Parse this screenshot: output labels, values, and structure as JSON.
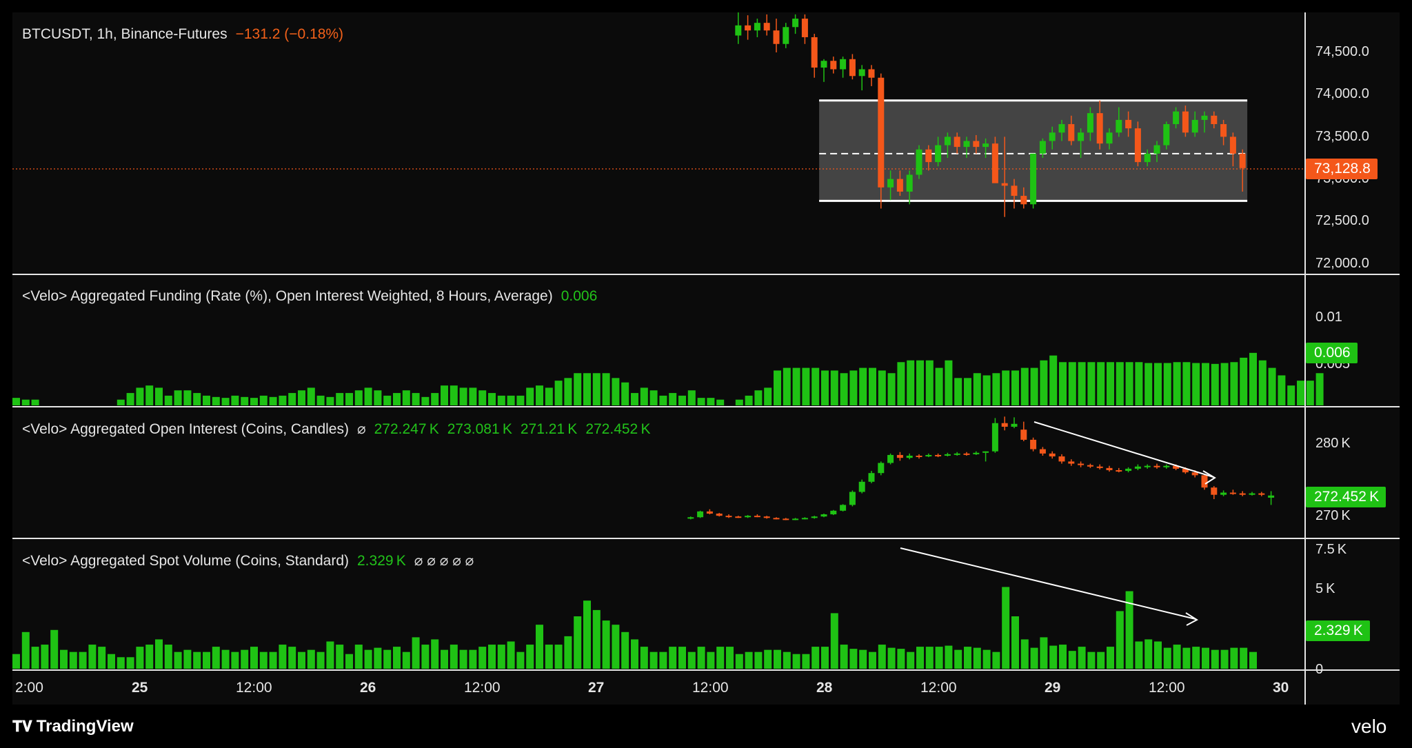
{
  "title": {
    "symbol": "BTCUSDT, 1h, Binance-Futures",
    "change": "−131.2 (−0.18%)"
  },
  "panes": {
    "funding": {
      "label": "<Velo> Aggregated Funding (Rate (%), Open Interest Weighted, 8 Hours, Average)",
      "value": "0.006"
    },
    "oi": {
      "label": "<Velo> Aggregated Open Interest (Coins, Candles)",
      "symbol": "⌀",
      "ohlc": [
        "272.247 K",
        "273.081 K",
        "271.21 K",
        "272.452 K"
      ]
    },
    "volume": {
      "label": "<Velo> Aggregated Spot Volume (Coins, Standard)",
      "value": "2.329 K",
      "symbols": "⌀  ⌀  ⌀  ⌀  ⌀"
    }
  },
  "price_axis": [
    "74,500.0",
    "74,000.0",
    "73,500.0",
    "73,000.0",
    "72,500.0",
    "72,000.0"
  ],
  "price_tag": "73,128.8",
  "funding_axis": [
    "0.01",
    "0.005"
  ],
  "funding_tag": "0.006",
  "oi_axis": [
    "280 K",
    "270 K"
  ],
  "oi_tag": "272.452 K",
  "vol_axis": [
    "7.5 K",
    "5 K",
    "0"
  ],
  "vol_tag": "2.329 K",
  "time_axis": [
    {
      "label": "2:00",
      "bold": false
    },
    {
      "label": "25",
      "bold": true
    },
    {
      "label": "12:00",
      "bold": false
    },
    {
      "label": "26",
      "bold": true
    },
    {
      "label": "12:00",
      "bold": false
    },
    {
      "label": "27",
      "bold": true
    },
    {
      "label": "12:00",
      "bold": false
    },
    {
      "label": "28",
      "bold": true
    },
    {
      "label": "12:00",
      "bold": false
    },
    {
      "label": "29",
      "bold": true
    },
    {
      "label": "12:00",
      "bold": false
    },
    {
      "label": "30",
      "bold": true
    }
  ],
  "branding": {
    "left": "TradingView",
    "right": "velo"
  },
  "colors": {
    "up": "#1fc214",
    "down": "#f4571a",
    "background": "#0b0b0b",
    "text": "#e6e6e6"
  },
  "chart_data": {
    "type": "candlestick",
    "interval": "1h",
    "x_unit": "hours since first hour shown (Mar 24 02:00)",
    "x_ticks": {
      "2:00": 0,
      "25": 22,
      "26": 46,
      "27": 70,
      "28": 94,
      "29": 118,
      "30": 142,
      "12:00": [
        34,
        58,
        82,
        106,
        130
      ]
    },
    "range_box": {
      "x_start": 84.5,
      "x_end": 129.5,
      "top": 73930,
      "bottom": 72740,
      "mid": 73300
    },
    "price_candles": [
      [
        76,
        74700,
        74980,
        74600,
        74820
      ],
      [
        77,
        74820,
        74940,
        74650,
        74760
      ],
      [
        78,
        74760,
        74900,
        74680,
        74850
      ],
      [
        79,
        74850,
        74950,
        74700,
        74760
      ],
      [
        80,
        74760,
        74900,
        74500,
        74600
      ],
      [
        81,
        74600,
        74850,
        74550,
        74800
      ],
      [
        82,
        74800,
        74950,
        74720,
        74900
      ],
      [
        83,
        74900,
        74950,
        74600,
        74680
      ],
      [
        84,
        74680,
        74720,
        74200,
        74320
      ],
      [
        85,
        74320,
        74420,
        74150,
        74400
      ],
      [
        86,
        74400,
        74450,
        74250,
        74300
      ],
      [
        87,
        74300,
        74450,
        74200,
        74420
      ],
      [
        88,
        74420,
        74480,
        74180,
        74220
      ],
      [
        89,
        74220,
        74350,
        74050,
        74300
      ],
      [
        90,
        74300,
        74350,
        74100,
        74200
      ],
      [
        91,
        74200,
        74250,
        72650,
        72900
      ],
      [
        92,
        72900,
        73100,
        72750,
        73000
      ],
      [
        93,
        73000,
        73100,
        72800,
        72850
      ],
      [
        94,
        72850,
        73100,
        72700,
        73050
      ],
      [
        95,
        73050,
        73400,
        73000,
        73350
      ],
      [
        96,
        73350,
        73400,
        73100,
        73200
      ],
      [
        97,
        73200,
        73500,
        73150,
        73400
      ],
      [
        98,
        73400,
        73550,
        73250,
        73500
      ],
      [
        99,
        73500,
        73550,
        73300,
        73380
      ],
      [
        100,
        73380,
        73500,
        73250,
        73450
      ],
      [
        101,
        73450,
        73520,
        73300,
        73380
      ],
      [
        102,
        73380,
        73480,
        73250,
        73420
      ],
      [
        103,
        73420,
        73500,
        73150,
        72950
      ],
      [
        104,
        72950,
        73500,
        72550,
        72920
      ],
      [
        105,
        72920,
        73000,
        72650,
        72800
      ],
      [
        106,
        72800,
        72900,
        72650,
        72700
      ],
      [
        107,
        72700,
        73300,
        72650,
        73300
      ],
      [
        108,
        73300,
        73480,
        73250,
        73450
      ],
      [
        109,
        73450,
        73620,
        73350,
        73550
      ],
      [
        110,
        73550,
        73700,
        73450,
        73650
      ],
      [
        111,
        73650,
        73750,
        73400,
        73450
      ],
      [
        112,
        73450,
        73600,
        73250,
        73550
      ],
      [
        113,
        73550,
        73850,
        73450,
        73780
      ],
      [
        114,
        73780,
        73930,
        73350,
        73420
      ],
      [
        115,
        73420,
        73600,
        73350,
        73550
      ],
      [
        116,
        73550,
        73850,
        73500,
        73700
      ],
      [
        117,
        73700,
        73800,
        73500,
        73600
      ],
      [
        118,
        73600,
        73680,
        73150,
        73200
      ],
      [
        119,
        73200,
        73350,
        73150,
        73300
      ],
      [
        120,
        73300,
        73450,
        73200,
        73400
      ],
      [
        121,
        73400,
        73680,
        73350,
        73650
      ],
      [
        122,
        73650,
        73850,
        73600,
        73800
      ],
      [
        123,
        73800,
        73870,
        73500,
        73550
      ],
      [
        124,
        73550,
        73800,
        73500,
        73700
      ],
      [
        125,
        73700,
        73800,
        73550,
        73750
      ],
      [
        126,
        73750,
        73800,
        73600,
        73650
      ],
      [
        127,
        73650,
        73700,
        73400,
        73500
      ],
      [
        128,
        73500,
        73550,
        73150,
        73300
      ],
      [
        129,
        73300,
        73350,
        72850,
        73129
      ]
    ],
    "funding_rate": [
      0.0017,
      0.0013,
      0.0013,
      0,
      0,
      0,
      0,
      0,
      0,
      0,
      0,
      0.0013,
      0.0028,
      0.004,
      0.0045,
      0.004,
      0.0022,
      0.0034,
      0.0034,
      0.0028,
      0.0022,
      0.0019,
      0.0017,
      0.0022,
      0.0019,
      0.0017,
      0.0022,
      0.0019,
      0.0022,
      0.0028,
      0.0034,
      0.004,
      0.0022,
      0.0019,
      0.0028,
      0.0028,
      0.0034,
      0.004,
      0.0034,
      0.0022,
      0.0028,
      0.0034,
      0.0028,
      0.0019,
      0.0028,
      0.0045,
      0.0045,
      0.004,
      0.004,
      0.0034,
      0.0028,
      0.0022,
      0.0022,
      0.0022,
      0.004,
      0.0045,
      0.004,
      0.0056,
      0.0062,
      0.0073,
      0.0073,
      0.0073,
      0.0073,
      0.0062,
      0.0052,
      0.0028,
      0.004,
      0.0034,
      0.0022,
      0.0028,
      0.0022,
      0.0034,
      0.0017,
      0.0017,
      0.0013,
      0,
      0.0013,
      0.0022,
      0.0034,
      0.004,
      0.0079,
      0.0085,
      0.0085,
      0.0085,
      0.0085,
      0.0079,
      0.0079,
      0.0073,
      0.0079,
      0.0085,
      0.0085,
      0.0079,
      0.0073,
      0.0098,
      0.0102,
      0.0102,
      0.0102,
      0.0085,
      0.0102,
      0.0062,
      0.0062,
      0.0073,
      0.0068,
      0.0073,
      0.0079,
      0.0079,
      0.0085,
      0.0085,
      0.0102,
      0.0113,
      0.0098,
      0.0098,
      0.0098,
      0.0098,
      0.0098,
      0.0098,
      0.0098,
      0.0098,
      0.0098,
      0.0096,
      0.0096,
      0.0096,
      0.0098,
      0.0098,
      0.0096,
      0.0096,
      0.0094,
      0.0096,
      0.0098,
      0.0108,
      0.0119,
      0.0102,
      0.0085,
      0.0068,
      0.0045,
      0.0056,
      0.0056,
      0.0073
    ],
    "open_interest_k": [
      [
        71,
        269.3,
        269.6,
        269.2,
        269.5
      ],
      [
        72,
        269.5,
        270.4,
        269.4,
        270.3
      ],
      [
        73,
        270.3,
        270.6,
        269.9,
        270.0
      ],
      [
        74,
        270.0,
        270.1,
        269.6,
        269.7
      ],
      [
        75,
        269.7,
        269.9,
        269.4,
        269.6
      ],
      [
        76,
        269.6,
        269.7,
        269.4,
        269.5
      ],
      [
        77,
        269.5,
        269.8,
        269.4,
        269.7
      ],
      [
        78,
        269.7,
        269.9,
        269.5,
        269.6
      ],
      [
        79,
        269.6,
        269.7,
        269.3,
        269.4
      ],
      [
        80,
        269.4,
        269.5,
        269.2,
        269.3
      ],
      [
        81,
        269.3,
        269.4,
        269.1,
        269.2
      ],
      [
        82,
        269.2,
        269.4,
        269.1,
        269.3
      ],
      [
        83,
        269.3,
        269.5,
        269.2,
        269.4
      ],
      [
        84,
        269.4,
        269.7,
        269.3,
        269.6
      ],
      [
        85,
        269.6,
        270.0,
        269.5,
        269.9
      ],
      [
        86,
        269.9,
        270.5,
        269.8,
        270.4
      ],
      [
        87,
        270.4,
        271.3,
        270.3,
        271.2
      ],
      [
        88,
        271.2,
        273.2,
        271.0,
        273.0
      ],
      [
        89,
        273.0,
        274.7,
        272.8,
        274.4
      ],
      [
        90,
        274.4,
        275.9,
        274.2,
        275.6
      ],
      [
        91,
        275.6,
        277.2,
        275.3,
        277.0
      ],
      [
        92,
        277.0,
        278.3,
        276.8,
        278.1
      ],
      [
        93,
        278.1,
        278.5,
        277.3,
        277.7
      ],
      [
        94,
        277.7,
        278.3,
        277.5,
        278.0
      ],
      [
        95,
        278.0,
        278.2,
        277.6,
        277.9
      ],
      [
        96,
        277.9,
        278.3,
        277.8,
        278.1
      ],
      [
        97,
        278.1,
        278.3,
        277.8,
        278.0
      ],
      [
        98,
        278.0,
        278.4,
        277.9,
        278.2
      ],
      [
        99,
        278.2,
        278.5,
        278.0,
        278.3
      ],
      [
        100,
        278.3,
        278.5,
        278.0,
        278.2
      ],
      [
        101,
        278.2,
        278.6,
        278.1,
        278.4
      ],
      [
        102,
        278.4,
        278.6,
        277.2,
        278.6
      ],
      [
        103,
        278.6,
        283.2,
        278.4,
        282.5
      ],
      [
        104,
        282.5,
        283.4,
        281.5,
        282.0
      ],
      [
        105,
        282.0,
        283.3,
        281.8,
        282.4
      ],
      [
        106,
        281.6,
        282.7,
        280.0,
        280.2
      ],
      [
        107,
        280.2,
        280.5,
        278.6,
        278.9
      ],
      [
        108,
        278.9,
        279.2,
        278.0,
        278.3
      ],
      [
        109,
        278.3,
        278.6,
        277.6,
        277.9
      ],
      [
        110,
        277.9,
        278.2,
        276.9,
        277.2
      ],
      [
        111,
        277.2,
        277.5,
        276.6,
        276.9
      ],
      [
        112,
        276.9,
        277.2,
        276.4,
        276.7
      ],
      [
        113,
        276.7,
        276.9,
        276.3,
        276.5
      ],
      [
        114,
        276.5,
        276.8,
        276.1,
        276.3
      ],
      [
        115,
        276.3,
        276.6,
        275.8,
        276.0
      ],
      [
        116,
        276.0,
        276.3,
        275.7,
        275.9
      ],
      [
        117,
        275.9,
        276.4,
        275.7,
        276.2
      ],
      [
        118,
        276.2,
        276.8,
        276.0,
        276.5
      ],
      [
        119,
        276.5,
        276.8,
        276.2,
        276.6
      ],
      [
        120,
        276.6,
        276.9,
        276.2,
        276.4
      ],
      [
        121,
        276.4,
        276.8,
        276.2,
        276.6
      ],
      [
        122,
        276.6,
        276.8,
        276.0,
        276.2
      ],
      [
        123,
        276.2,
        276.4,
        275.5,
        275.7
      ],
      [
        124,
        275.7,
        276.0,
        275.0,
        275.3
      ],
      [
        125,
        275.3,
        275.5,
        273.3,
        273.6
      ],
      [
        126,
        273.6,
        273.8,
        272.0,
        272.6
      ],
      [
        127,
        272.6,
        273.2,
        272.4,
        272.9
      ],
      [
        128,
        272.9,
        273.3,
        272.6,
        272.8
      ],
      [
        129,
        272.8,
        273.1,
        272.4,
        272.6
      ],
      [
        130,
        272.6,
        273.0,
        272.5,
        272.8
      ],
      [
        131,
        272.8,
        273.0,
        272.4,
        272.6
      ],
      [
        132,
        272.2,
        273.1,
        271.2,
        272.5
      ]
    ],
    "spot_volume_k": [
      1.4,
      3.5,
      2.1,
      2.3,
      3.7,
      1.8,
      1.6,
      1.6,
      2.3,
      2.1,
      1.4,
      1.1,
      1.1,
      2.1,
      2.3,
      2.8,
      2.3,
      1.6,
      1.8,
      1.6,
      1.6,
      2.1,
      1.8,
      1.6,
      1.8,
      2.1,
      1.6,
      1.6,
      2.3,
      2.1,
      1.6,
      1.8,
      1.6,
      2.6,
      2.3,
      1.4,
      2.3,
      1.8,
      2.0,
      1.8,
      2.1,
      1.6,
      3.0,
      2.3,
      2.8,
      1.8,
      2.3,
      1.8,
      1.8,
      2.1,
      2.3,
      2.3,
      2.6,
      1.6,
      2.3,
      4.2,
      2.3,
      2.3,
      3.1,
      5.0,
      6.5,
      5.6,
      4.6,
      4.2,
      3.5,
      2.8,
      2.1,
      1.6,
      1.6,
      2.1,
      2.1,
      1.6,
      2.1,
      1.6,
      2.1,
      2.1,
      1.4,
      1.6,
      1.6,
      1.8,
      1.6,
      1.6,
      1.4,
      1.4,
      1.6,
      1.8,
      2.1,
      2.1,
      2.3,
      2.0,
      1.6,
      2.0,
      1.8,
      1.6,
      2.1,
      2.3,
      2.1,
      1.8,
      1.6,
      2.1,
      2.3,
      1.6,
      2.1,
      5.5,
      3.5,
      3.0,
      2.6,
      2.8,
      2.1,
      2.3,
      1.6,
      2.3,
      2.1,
      1.8,
      1.9,
      1.8,
      2.1,
      2.1,
      1.8,
      1.6,
      1.8,
      2.1,
      2.1,
      1.9,
      1.8,
      2.3,
      2.8,
      2.3,
      1.6,
      1.8,
      1.6,
      1.9,
      1.6,
      2.0,
      1.9,
      1.8,
      2.2,
      1.8,
      1.6,
      1.9,
      1.6,
      1.8,
      2.3,
      1.6,
      1.4,
      1.6,
      1.5,
      1.6,
      1.8,
      1.6,
      2.0,
      1.8,
      1.9,
      2.0,
      2.1,
      2.3,
      2.1,
      1.7,
      2.2,
      2.0,
      1.7,
      2.0,
      2.0,
      1.9,
      2.0,
      2.3
    ],
    "volume_extra_bars": {
      "note": "spot volume bars between 80 and 130 hours",
      "values": [
        1.8,
        1.6,
        1.4,
        1.4,
        2.1,
        2.1,
        5.3,
        2.3,
        1.9,
        1.8,
        1.6,
        2.3,
        2.0,
        1.9,
        1.6,
        2.1,
        2.1,
        2.1,
        2.2,
        1.8,
        2.1,
        2.0,
        1.8,
        1.6,
        7.8,
        5.0,
        2.8,
        2.0,
        3.0,
        2.2,
        2.3,
        1.7,
        2.1,
        1.6,
        1.6,
        2.1,
        5.5,
        7.4,
        2.6,
        2.8,
        2.6,
        2.0,
        2.3,
        2.0,
        2.1,
        2.0,
        1.8,
        1.8,
        2.0,
        2.0,
        1.6
      ]
    }
  }
}
